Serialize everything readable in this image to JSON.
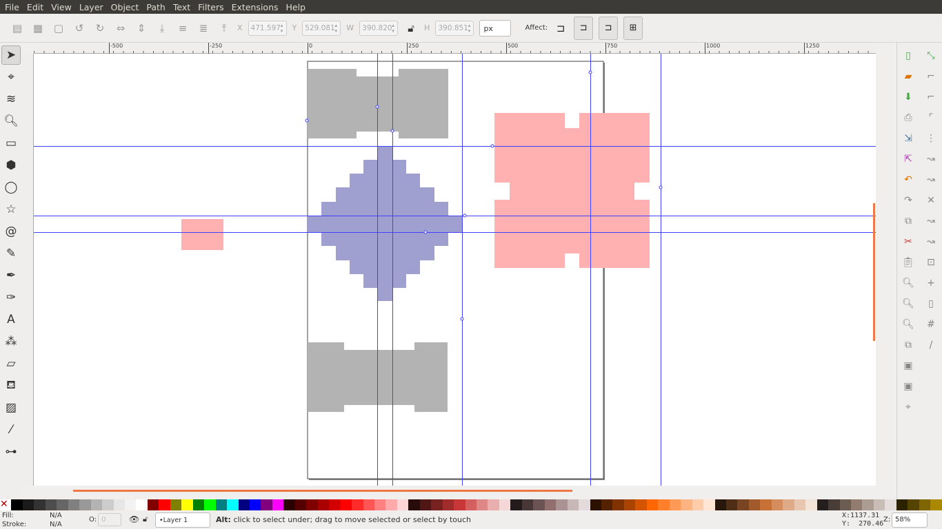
{
  "menu": [
    "File",
    "Edit",
    "View",
    "Layer",
    "Object",
    "Path",
    "Text",
    "Filters",
    "Extensions",
    "Help"
  ],
  "toolbar": {
    "x_label": "X",
    "x": "471.597",
    "y_label": "Y",
    "y": "529.081",
    "w_label": "W",
    "w": "390.820",
    "h_label": "H",
    "h": "390.851",
    "unit": "px",
    "affect_label": "Affect:"
  },
  "ruler_top": [
    "-500",
    "-250",
    "0",
    "250",
    "500",
    "750",
    "1000",
    "1250"
  ],
  "tools": [
    "select-arrow",
    "node-editor",
    "tweak",
    "zoom",
    "rectangle",
    "3d-box",
    "ellipse",
    "star",
    "spiral",
    "pencil",
    "pen",
    "calligraphy",
    "text",
    "spray",
    "eraser",
    "paint-bucket",
    "gradient",
    "dropper",
    "connector"
  ],
  "palette": [
    "#000000",
    "#1a1a1a",
    "#333333",
    "#4d4d4d",
    "#666666",
    "#808080",
    "#999999",
    "#b3b3b3",
    "#cccccc",
    "#e6e6e6",
    "#f2f2f2",
    "#ffffff",
    "#800000",
    "#ff0000",
    "#808000",
    "#ffff00",
    "#008000",
    "#00ff00",
    "#008080",
    "#00ffff",
    "#000080",
    "#0000ff",
    "#800080",
    "#ff00ff",
    "#2b0000",
    "#550000",
    "#800000",
    "#aa0000",
    "#d40000",
    "#ff0000",
    "#ff2a2a",
    "#ff5555",
    "#ff8080",
    "#ffaaaa",
    "#ffd5d5",
    "#280b0b",
    "#501616",
    "#782121",
    "#a02c2c",
    "#c83737",
    "#d35f5f",
    "#de8787",
    "#e9afaf",
    "#f4d7d7",
    "#241c1c",
    "#483737",
    "#6c5353",
    "#916f6f",
    "#ac9393",
    "#c8b7b7",
    "#e3dbdb",
    "#2b1100",
    "#552200",
    "#803300",
    "#aa4400",
    "#d45500",
    "#ff6600",
    "#ff7f2a",
    "#ff9955",
    "#ffb380",
    "#ffccaa",
    "#ffe6d5",
    "#28170b",
    "#502d16",
    "#784421",
    "#a05a2c",
    "#c87137",
    "#d38d5f",
    "#deaa87",
    "#e9c6af",
    "#f4e3d7",
    "#241f1c",
    "#483e37",
    "#6c5d53",
    "#917c6f",
    "#ac9d93",
    "#c8beb7",
    "#e3dedb",
    "#2b2200",
    "#554400",
    "#806600",
    "#aa8800"
  ],
  "status": {
    "fill_label": "Fill:",
    "fill": "N/A",
    "stroke_label": "Stroke:",
    "stroke": "N/A",
    "opacity_label": "O:",
    "opacity": "0",
    "layer": "•Layer 1",
    "message_bold": "Alt:",
    "message": " click to select under; drag to move selected or select by touch",
    "cursor_x": "X:1137.31",
    "cursor_y": "Y:  270.46",
    "zoom_label": "Z:",
    "zoom": "58%"
  },
  "colors": {
    "accent": "#f07746",
    "gray_shape": "#b3b3b3",
    "blue_shape": "#a0a0d0",
    "pink_shape": "#ffb0b0",
    "guide": "#4040ff"
  }
}
